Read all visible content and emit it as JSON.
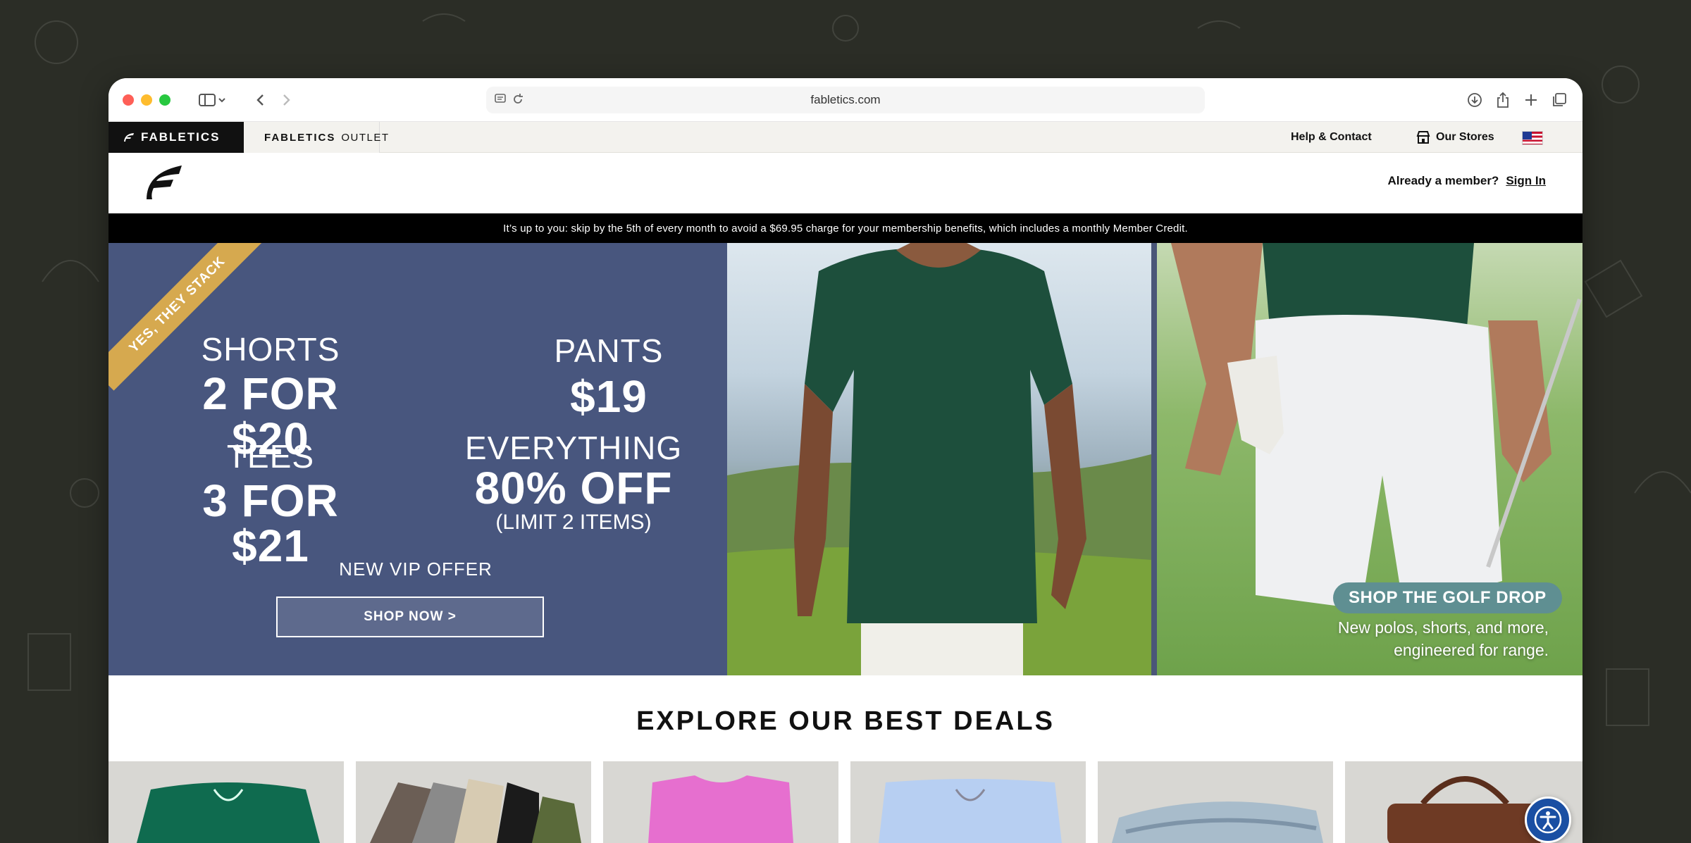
{
  "browser": {
    "url": "fabletics.com"
  },
  "utility_bar": {
    "brand_main": "FABLETICS",
    "brand_outlet_bold": "FABLETICS",
    "brand_outlet_light": "OUTLET",
    "help_label": "Help & Contact",
    "stores_label": "Our Stores",
    "flag_icon": "us-flag-icon"
  },
  "header": {
    "member_prompt": "Already a member?",
    "sign_in": "Sign In"
  },
  "banner": {
    "text": "It’s up to you: skip by the 5th of every month to avoid a $69.95 charge for your membership benefits, which includes a monthly Member Credit."
  },
  "promo": {
    "ribbon": "YES, THEY STACK",
    "shorts_label": "SHORTS",
    "shorts_price": "2 FOR $20",
    "pants_label": "PANTS",
    "pants_price": "$19",
    "tees_label": "TEES",
    "tees_price": "3 FOR $21",
    "everything_label": "EVERYTHING",
    "everything_price": "80% OFF",
    "everything_limit": "(LIMIT 2 ITEMS)",
    "vip": "NEW VIP OFFER",
    "cta": "SHOP NOW >"
  },
  "golf": {
    "cta": "SHOP THE GOLF DROP",
    "line1": "New polos, shorts, and more,",
    "line2": "engineered for range."
  },
  "deals": {
    "title": "EXPLORE OUR BEST DEALS",
    "tiles": [
      "green-shorts",
      "folded-pants",
      "pink-tee",
      "light-blue-shorts",
      "folded-jeans",
      "brown-bag"
    ]
  },
  "colors": {
    "promo_bg": "#48567e",
    "ribbon": "#d6a94f",
    "golf_cta": "#5f8f92",
    "accessibility": "#1a4fa3"
  }
}
